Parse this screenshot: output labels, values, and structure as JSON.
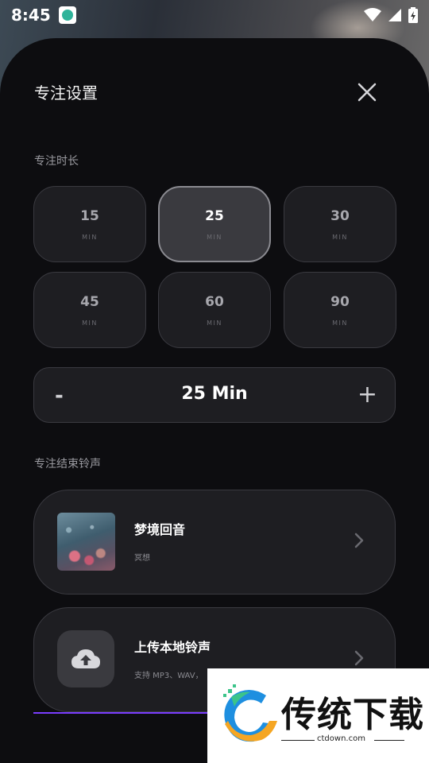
{
  "status_bar": {
    "time": "8:45"
  },
  "sheet": {
    "title": "专注设置"
  },
  "duration": {
    "label": "专注时长",
    "options": [
      {
        "value": "15",
        "unit": "MIN"
      },
      {
        "value": "25",
        "unit": "MIN"
      },
      {
        "value": "30",
        "unit": "MIN"
      },
      {
        "value": "45",
        "unit": "MIN"
      },
      {
        "value": "60",
        "unit": "MIN"
      },
      {
        "value": "90",
        "unit": "MIN"
      }
    ],
    "selected": "25"
  },
  "stepper": {
    "minus": "-",
    "value": "25 Min",
    "plus": "+"
  },
  "ringtone": {
    "label": "专注结束铃声",
    "items": [
      {
        "title": "梦境回音",
        "subtitle": "冥想"
      },
      {
        "title": "上传本地铃声",
        "subtitle": "支持 MP3、WAV，"
      }
    ]
  },
  "watermark": {
    "text": "传统下载",
    "url": "ctdown.com"
  },
  "colors": {
    "accent": "#7a3cff",
    "sheet_bg": "#0d0d10",
    "card_bg": "#1e1e22"
  }
}
